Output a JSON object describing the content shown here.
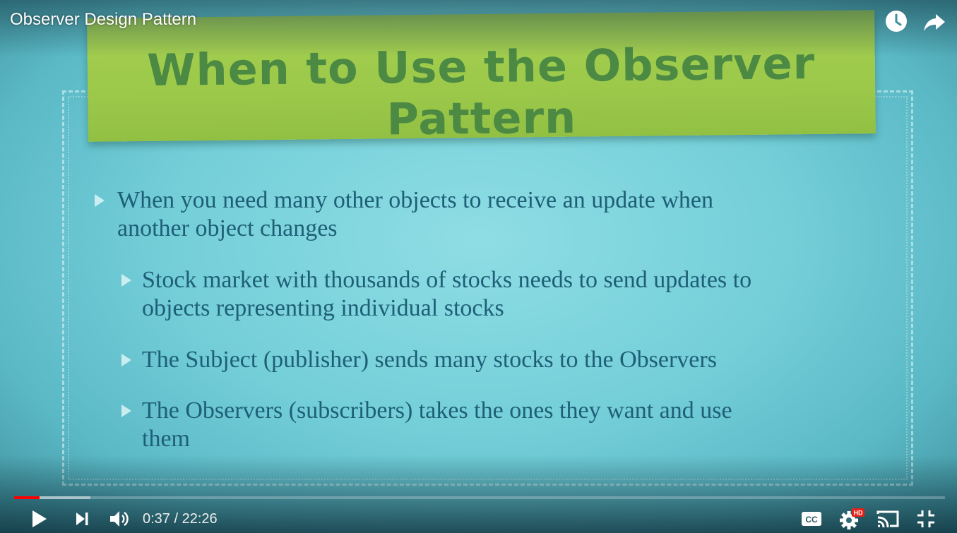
{
  "player": {
    "video_title": "Observer Design Pattern",
    "time_current": "0:37",
    "time_separator": " / ",
    "time_total": "22:26",
    "progress_played_fraction": 0.0275,
    "progress_buffered_fraction": 0.082,
    "accent_color": "#ff0000",
    "icons": {
      "watch_later": "clock-icon",
      "share": "share-arrow-icon",
      "play": "play-icon",
      "next": "next-icon",
      "volume": "volume-icon",
      "captions": "cc-icon",
      "settings": "gear-icon",
      "hd_badge": "HD",
      "cast": "cast-icon",
      "exit_fullscreen": "exit-fullscreen-icon"
    }
  },
  "slide": {
    "title": "When to Use the Observer Pattern",
    "bullets": [
      {
        "level": 1,
        "lines": [
          "When you need many other objects to receive an update when",
          "another object changes"
        ]
      },
      {
        "level": 2,
        "lines": [
          "Stock market with thousands of stocks needs to send updates to",
          "objects representing individual stocks"
        ]
      },
      {
        "level": 2,
        "lines": [
          "The Subject (publisher) sends many stocks to the Observers"
        ]
      },
      {
        "level": 2,
        "lines": [
          "The Observers (subscribers) takes the ones they want and use",
          "them"
        ]
      }
    ],
    "colors": {
      "banner": "#9cc94a",
      "banner_text": "#4c8a44",
      "body_text": "#1e5f77",
      "background": "#74cfd9"
    }
  }
}
